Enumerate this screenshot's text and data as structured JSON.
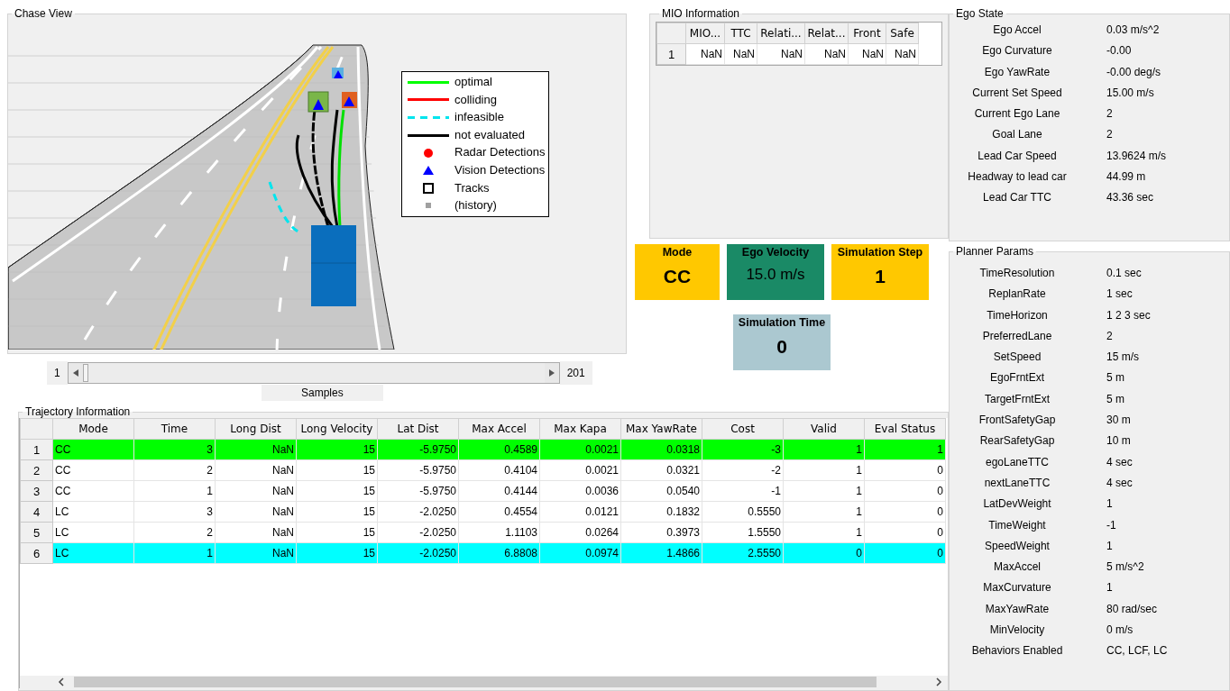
{
  "chase_view": {
    "title": "Chase View",
    "legend": [
      {
        "label": "optimal",
        "kind": "line",
        "color": "#00ff00"
      },
      {
        "label": "colliding",
        "kind": "line",
        "color": "#ff0000"
      },
      {
        "label": "infeasible",
        "kind": "dashed",
        "color": "#00e5ee"
      },
      {
        "label": "not evaluated",
        "kind": "line",
        "color": "#000000"
      },
      {
        "label": "Radar Detections",
        "kind": "circle",
        "color": "#ff0000"
      },
      {
        "label": "Vision Detections",
        "kind": "triangle",
        "color": "#0000ff"
      },
      {
        "label": "Tracks",
        "kind": "square",
        "color": "#000000"
      },
      {
        "label": "(history)",
        "kind": "small-square",
        "color": "#a0a0a0"
      }
    ]
  },
  "samples_slider": {
    "min": "1",
    "max": "201",
    "label": "Samples",
    "level": 0
  },
  "mio_information": {
    "title": "MIO Information",
    "columns": [
      "MIO...",
      "TTC",
      "Relati...",
      "Relat...",
      "Front",
      "Safe"
    ],
    "rows": [
      {
        "index": "1",
        "cells": [
          "NaN",
          "NaN",
          "NaN",
          "NaN",
          "NaN",
          "NaN"
        ]
      }
    ]
  },
  "tiles": [
    {
      "label": "Mode",
      "value": "CC",
      "color": "#ffc800"
    },
    {
      "label": "Ego Velocity",
      "value": "15.0 m/s",
      "color": "#1a8a66"
    },
    {
      "label": "Simulation Step",
      "value": "1",
      "color": "#ffc800"
    },
    {
      "label": "Simulation Time",
      "value": "0",
      "color": "#abc8d0"
    }
  ],
  "trajectory_information": {
    "title": "Trajectory Information",
    "columns": [
      "Mode",
      "Time",
      "Long Dist",
      "Long Velocity",
      "Lat Dist",
      "Max Accel",
      "Max Kapa",
      "Max YawRate",
      "Cost",
      "Valid",
      "Eval Status"
    ],
    "rows": [
      {
        "index": "1",
        "color": "#00ff00",
        "cells": [
          "CC",
          "3",
          "NaN",
          "15",
          "-5.9750",
          "0.4589",
          "0.0021",
          "0.0318",
          "-3",
          "1",
          "1"
        ]
      },
      {
        "index": "2",
        "color": "#ffffff",
        "cells": [
          "CC",
          "2",
          "NaN",
          "15",
          "-5.9750",
          "0.4104",
          "0.0021",
          "0.0321",
          "-2",
          "1",
          "0"
        ]
      },
      {
        "index": "3",
        "color": "#ffffff",
        "cells": [
          "CC",
          "1",
          "NaN",
          "15",
          "-5.9750",
          "0.4144",
          "0.0036",
          "0.0540",
          "-1",
          "1",
          "0"
        ]
      },
      {
        "index": "4",
        "color": "#ffffff",
        "cells": [
          "LC",
          "3",
          "NaN",
          "15",
          "-2.0250",
          "0.4554",
          "0.0121",
          "0.1832",
          "0.5550",
          "1",
          "0"
        ]
      },
      {
        "index": "5",
        "color": "#ffffff",
        "cells": [
          "LC",
          "2",
          "NaN",
          "15",
          "-2.0250",
          "1.1103",
          "0.0264",
          "0.3973",
          "1.5550",
          "1",
          "0"
        ]
      },
      {
        "index": "6",
        "color": "#00ffff",
        "cells": [
          "LC",
          "1",
          "NaN",
          "15",
          "-2.0250",
          "6.8808",
          "0.0974",
          "1.4866",
          "2.5550",
          "0",
          "0"
        ]
      }
    ]
  },
  "ego_state": {
    "title": "Ego State",
    "items": [
      {
        "label": "Ego Accel",
        "value": "0.03 m/s^2"
      },
      {
        "label": "Ego Curvature",
        "value": "-0.00"
      },
      {
        "label": "Ego YawRate",
        "value": "-0.00 deg/s"
      },
      {
        "label": "Current Set Speed",
        "value": "15.00 m/s"
      },
      {
        "label": "Current Ego Lane",
        "value": "2"
      },
      {
        "label": "Goal Lane",
        "value": "2"
      },
      {
        "label": "Lead Car Speed",
        "value": "13.9624 m/s"
      },
      {
        "label": "Headway to lead car",
        "value": "44.99 m"
      },
      {
        "label": "Lead Car TTC",
        "value": "43.36 sec"
      }
    ]
  },
  "planner_params": {
    "title": "Planner Params",
    "items": [
      {
        "label": "TimeResolution",
        "value": "0.1 sec"
      },
      {
        "label": "ReplanRate",
        "value": "1 sec"
      },
      {
        "label": "TimeHorizon",
        "value": "1  2  3 sec"
      },
      {
        "label": "PreferredLane",
        "value": "2"
      },
      {
        "label": "SetSpeed",
        "value": "15 m/s"
      },
      {
        "label": "EgoFrntExt",
        "value": "5 m"
      },
      {
        "label": "TargetFrntExt",
        "value": "5 m"
      },
      {
        "label": "FrontSafetyGap",
        "value": "30 m"
      },
      {
        "label": "RearSafetyGap",
        "value": "10 m"
      },
      {
        "label": "egoLaneTTC",
        "value": "4 sec"
      },
      {
        "label": "nextLaneTTC",
        "value": "4 sec"
      },
      {
        "label": "LatDevWeight",
        "value": "1"
      },
      {
        "label": "TimeWeight",
        "value": "-1"
      },
      {
        "label": "SpeedWeight",
        "value": "1"
      },
      {
        "label": "MaxAccel",
        "value": "5 m/s^2"
      },
      {
        "label": "MaxCurvature",
        "value": "1"
      },
      {
        "label": "MaxYawRate",
        "value": "80 rad/sec"
      },
      {
        "label": "MinVelocity",
        "value": "0 m/s"
      },
      {
        "label": "Behaviors Enabled",
        "value": "CC, LCF, LC"
      }
    ]
  }
}
